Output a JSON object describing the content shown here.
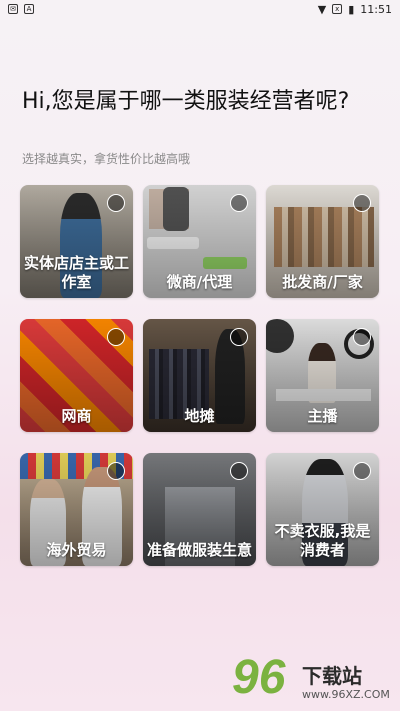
{
  "status_bar": {
    "time": "11:51"
  },
  "header": {
    "title": "Hi,您是属于哪一类服装经营者呢?",
    "subtitle": "选择越真实，拿货性价比越高哦"
  },
  "categories": [
    {
      "label": "实体店店主或工作室"
    },
    {
      "label": "微商/代理"
    },
    {
      "label": "批发商/厂家"
    },
    {
      "label": "网商"
    },
    {
      "label": "地摊"
    },
    {
      "label": "主播"
    },
    {
      "label": "海外贸易"
    },
    {
      "label": "准备做服装生意"
    },
    {
      "label": "不卖衣服,我是消费者"
    }
  ],
  "watermark": {
    "logo_text": "96",
    "name": "下载站",
    "url": "www.96XZ.COM"
  }
}
